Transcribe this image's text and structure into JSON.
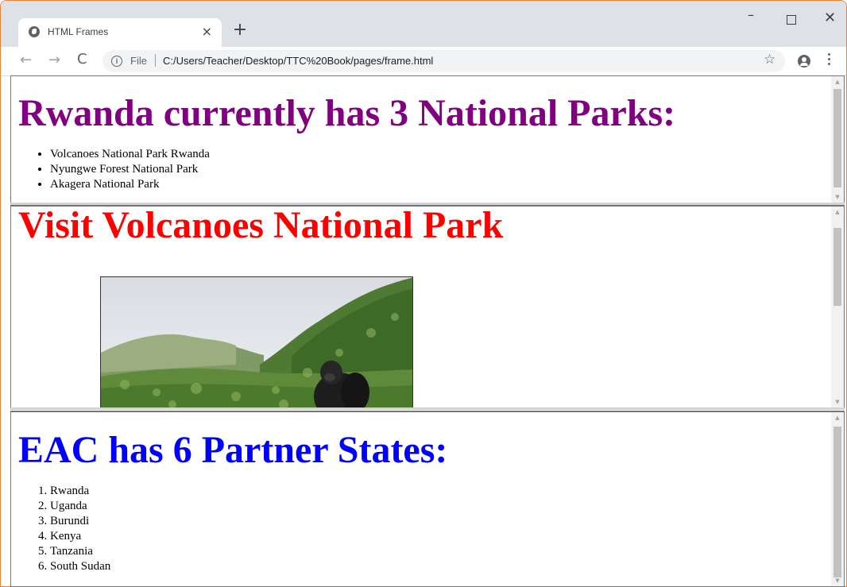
{
  "browser": {
    "tab_title": "HTML Frames",
    "tab_close": "×",
    "new_tab": "+",
    "window_controls": {
      "minimize": "–",
      "close": "✕"
    },
    "scheme_label": "File",
    "url": "C:/Users/Teacher/Desktop/TTC%20Book/pages/frame.html"
  },
  "frame1": {
    "heading": "Rwanda currently has 3 National Parks:",
    "items": [
      "Volcanoes National Park Rwanda",
      "Nyungwe Forest National Park",
      "Akagera National Park"
    ]
  },
  "frame2": {
    "heading": "Visit Volcanoes National Park"
  },
  "frame3": {
    "heading": "EAC has 6 Partner States:",
    "items": [
      "Rwanda",
      "Uganda",
      "Burundi",
      "Kenya",
      "Tanzania",
      "South Sudan"
    ]
  },
  "colors": {
    "frame1_heading": "#800080",
    "frame2_heading": "#ff0000",
    "frame3_heading": "#0000ff",
    "window_accent": "#e8823a"
  }
}
